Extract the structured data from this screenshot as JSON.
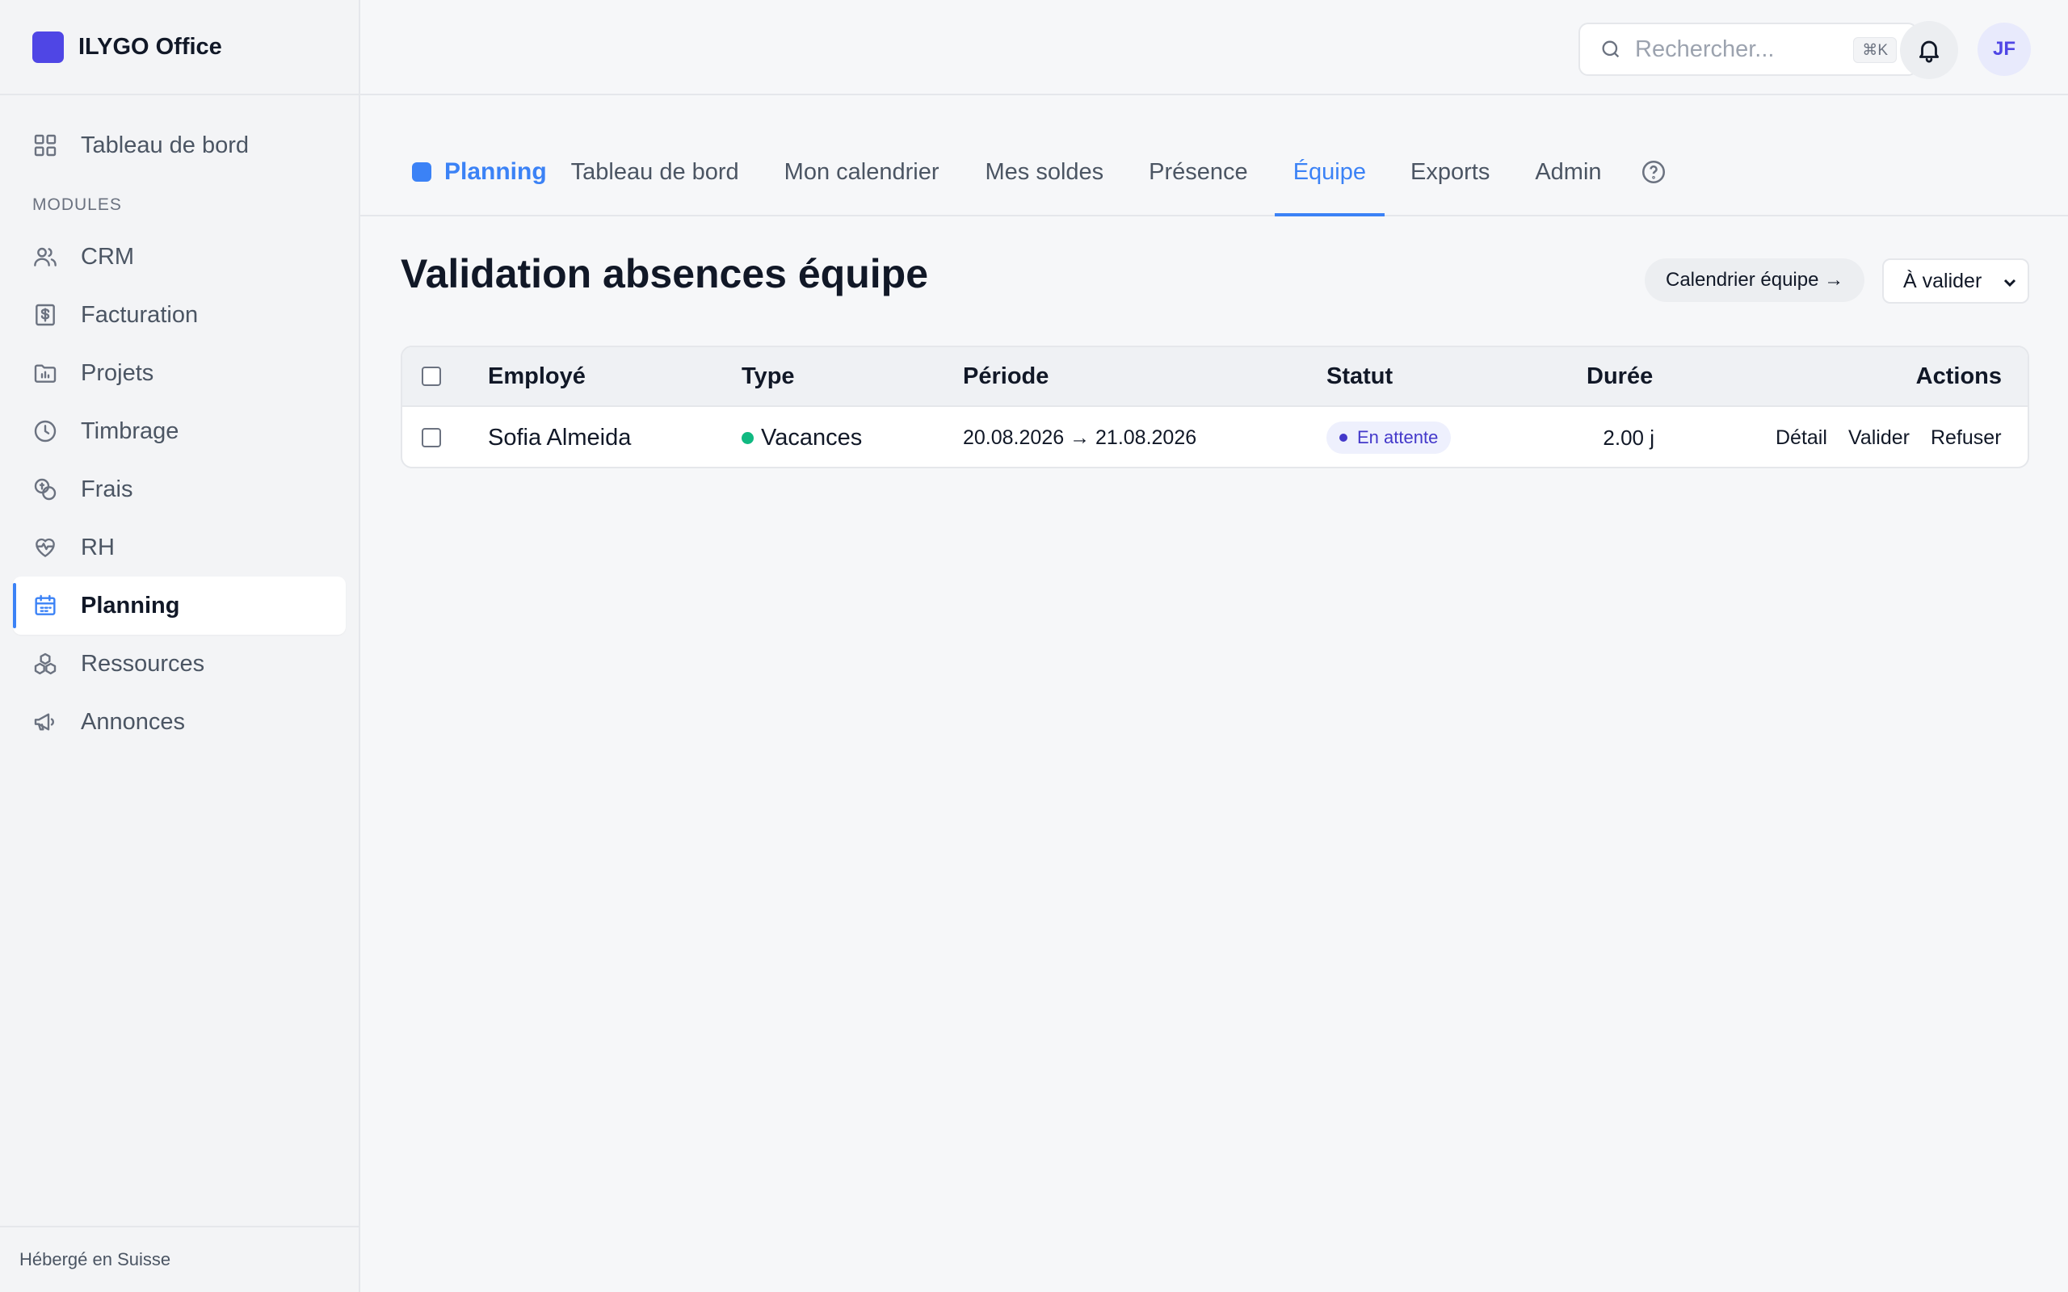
{
  "brand": {
    "name": "ILYGO Office",
    "logo_color": "#4f46e5"
  },
  "sidebar": {
    "top_item": {
      "label": "Tableau de bord",
      "icon": "dashboard-grid-icon"
    },
    "section_label": "MODULES",
    "items": [
      {
        "label": "CRM",
        "icon": "users-icon"
      },
      {
        "label": "Facturation",
        "icon": "invoice-dollar-icon"
      },
      {
        "label": "Projets",
        "icon": "folder-chart-icon"
      },
      {
        "label": "Timbrage",
        "icon": "clock-icon"
      },
      {
        "label": "Frais",
        "icon": "coins-icon"
      },
      {
        "label": "RH",
        "icon": "heart-pulse-icon"
      },
      {
        "label": "Planning",
        "icon": "calendar-icon",
        "active": true
      },
      {
        "label": "Ressources",
        "icon": "boxes-icon"
      },
      {
        "label": "Annonces",
        "icon": "megaphone-icon"
      }
    ],
    "footer": "Hébergé en Suisse"
  },
  "topbar": {
    "search_placeholder": "Rechercher...",
    "search_shortcut": "⌘K",
    "avatar_initials": "JF"
  },
  "tabs": {
    "module_label": "Planning",
    "items": [
      {
        "label": "Tableau de bord"
      },
      {
        "label": "Mon calendrier"
      },
      {
        "label": "Mes soldes"
      },
      {
        "label": "Présence"
      },
      {
        "label": "Équipe",
        "active": true
      },
      {
        "label": "Exports"
      },
      {
        "label": "Admin"
      }
    ]
  },
  "page": {
    "title": "Validation absences équipe",
    "team_calendar_button": "Calendrier équipe →",
    "filter_selected": "À valider"
  },
  "table": {
    "headers": {
      "employee": "Employé",
      "type": "Type",
      "period": "Période",
      "status": "Statut",
      "duration": "Durée",
      "actions": "Actions"
    },
    "rows": [
      {
        "employee": "Sofia Almeida",
        "type": "Vacances",
        "type_color": "#10b981",
        "period": "20.08.2026 → 21.08.2026",
        "status": "En attente",
        "duration": "2.00 j",
        "actions": {
          "detail": "Détail",
          "approve": "Valider",
          "reject": "Refuser"
        }
      }
    ]
  },
  "colors": {
    "accent": "#3b82f6",
    "danger": "#dc2626",
    "status_pending": "#4338ca"
  }
}
